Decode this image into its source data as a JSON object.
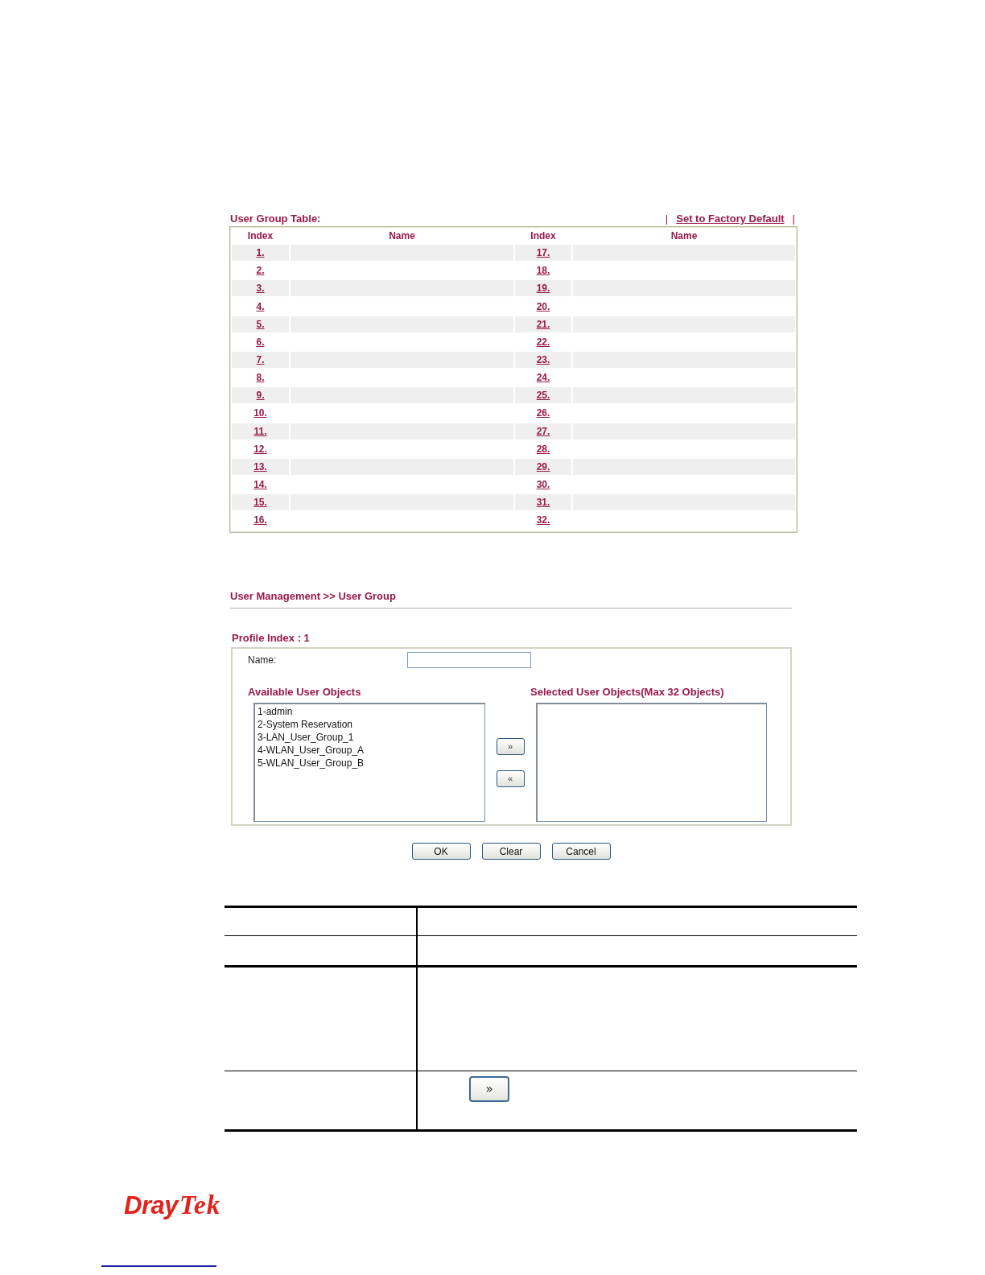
{
  "user_group_table": {
    "title": "User Group Table:",
    "links": [
      {
        "kind": "separator",
        "text": "|"
      },
      {
        "kind": "link",
        "text": "Set to Factory Default"
      },
      {
        "kind": "separator",
        "text": "|"
      }
    ],
    "columns": [
      "Index",
      "Name",
      "Index",
      "Name"
    ],
    "rows": [
      {
        "left_index": "1.",
        "right_index": "17."
      },
      {
        "left_index": "2.",
        "right_index": "18."
      },
      {
        "left_index": "3.",
        "right_index": "19."
      },
      {
        "left_index": "4.",
        "right_index": "20."
      },
      {
        "left_index": "5.",
        "right_index": "21."
      },
      {
        "left_index": "6.",
        "right_index": "22."
      },
      {
        "left_index": "7.",
        "right_index": "23."
      },
      {
        "left_index": "8.",
        "right_index": "24."
      },
      {
        "left_index": "9.",
        "right_index": "25."
      },
      {
        "left_index": "10.",
        "right_index": "26."
      },
      {
        "left_index": "11.",
        "right_index": "27."
      },
      {
        "left_index": "12.",
        "right_index": "28."
      },
      {
        "left_index": "13.",
        "right_index": "29."
      },
      {
        "left_index": "14.",
        "right_index": "30."
      },
      {
        "left_index": "15.",
        "right_index": "31."
      },
      {
        "left_index": "16.",
        "right_index": "32."
      }
    ]
  },
  "user_group_form": {
    "breadcrumb": "User Management >> User Group",
    "profile_index": "Profile Index : 1",
    "name_field": {
      "label": "Name:"
    },
    "available_objects": {
      "title": "Available User Objects",
      "items": [
        {
          "label": "1-admin",
          "selected": false
        },
        {
          "label": "2-System Reservation",
          "selected": false
        },
        {
          "label": "3-LAN_User_Group_1",
          "selected": false
        },
        {
          "label": "4-WLAN_User_Group_A",
          "selected": false
        },
        {
          "label": "5-WLAN_User_Group_B",
          "selected": false
        }
      ]
    },
    "selected_objects": {
      "title": "Selected User Objects(Max 32 Objects)"
    },
    "move_buttons": [
      "»",
      "«"
    ],
    "buttons": [
      "OK",
      "Clear",
      "Cancel"
    ]
  },
  "description_table": {
    "rows": [
      {
        "kind": "header"
      },
      {
        "kind": "short"
      },
      {
        "kind": "tall"
      },
      {
        "kind": "button",
        "button": "»"
      }
    ]
  },
  "logo": {
    "parts": [
      "Dray",
      "Tek"
    ]
  }
}
